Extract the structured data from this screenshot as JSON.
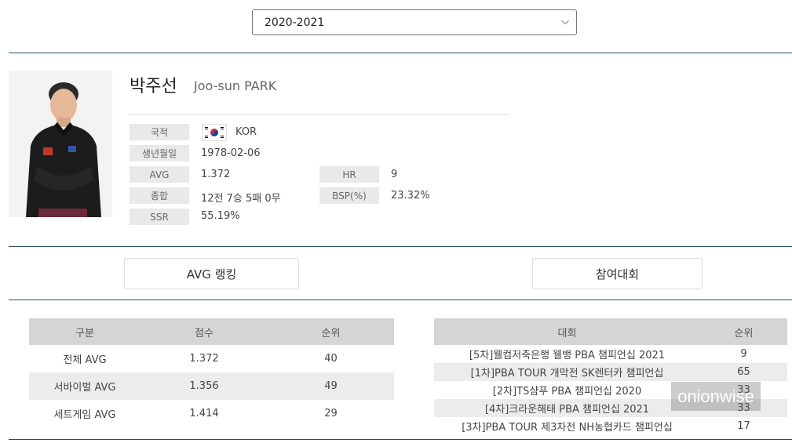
{
  "season": {
    "selected": "2020-2021"
  },
  "player": {
    "name_ko": "박주선",
    "name_en": "Joo-sun PARK",
    "photo_icon": "player-photo"
  },
  "profile": {
    "nationality_label": "국적",
    "nationality_value": "KOR",
    "flag_icon": "korea-flag-icon",
    "birth_label": "생년월일",
    "birth_value": "1978-02-06",
    "avg_label": "AVG",
    "avg_value": "1.372",
    "hr_label": "HR",
    "hr_value": "9",
    "record_label": "종합",
    "record_value": "12전 7승 5패 0무",
    "bsp_label": "BSP(%)",
    "bsp_value": "23.32%",
    "ssr_label": "SSR",
    "ssr_value": "55.19%"
  },
  "buttons": {
    "avg_ranking": "AVG 랭킹",
    "tournaments": "참여대회"
  },
  "avg_table": {
    "headers": [
      "구분",
      "점수",
      "순위"
    ],
    "rows": [
      [
        "전체 AVG",
        "1.372",
        "40"
      ],
      [
        "서바이벌 AVG",
        "1.356",
        "49"
      ],
      [
        "세트게임 AVG",
        "1.414",
        "29"
      ]
    ]
  },
  "tournament_table": {
    "headers": [
      "대회",
      "순위"
    ],
    "rows": [
      [
        "[5차]웰컴저축은행 웰뱅 PBA 챔피언십 2021",
        "9"
      ],
      [
        "[1차]PBA TOUR 개막전 SK렌터카 챔피언십",
        "65"
      ],
      [
        "[2차]TS샴푸 PBA 챔피언십 2020",
        "33"
      ],
      [
        "[4차]크라운해태 PBA 챔피언십 2021",
        "33"
      ],
      [
        "[3차]PBA TOUR 제3차전 NH농협카드 챔피언십",
        "17"
      ]
    ]
  },
  "watermark": "onionwise",
  "colors": {
    "rule": "#2d4a68",
    "header_bg": "#d5d5d5",
    "label_bg": "#e9e9e9"
  }
}
